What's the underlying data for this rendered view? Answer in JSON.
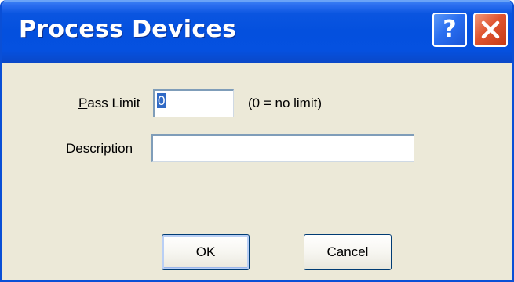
{
  "window": {
    "title": "Process Devices"
  },
  "titlebar": {
    "help_icon": "question-mark-icon",
    "close_icon": "close-x-icon"
  },
  "form": {
    "pass_limit": {
      "label_mnemonic": "P",
      "label_rest": "ass Limit",
      "value": "0",
      "hint": "(0 = no limit)"
    },
    "description": {
      "label_mnemonic": "D",
      "label_rest": "escription",
      "value": ""
    }
  },
  "buttons": {
    "ok_label": "OK",
    "cancel_label": "Cancel"
  },
  "colors": {
    "titlebar": "#0450de",
    "close_button": "#e0542f",
    "dialog_background": "#ece9d8",
    "selection": "#316ac5"
  }
}
